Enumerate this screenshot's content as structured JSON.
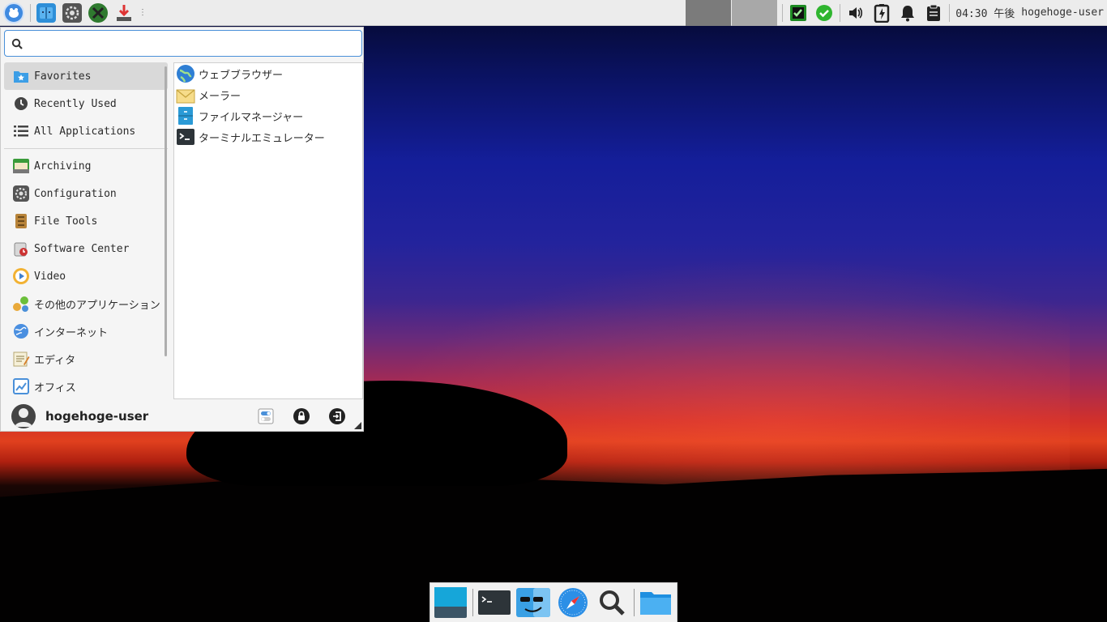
{
  "panel": {
    "clock": "04:30 午後",
    "user": "hogehoge-user",
    "handle": "⋮"
  },
  "menu": {
    "search": {
      "value": "",
      "placeholder": ""
    },
    "categories": [
      {
        "label": "Favorites",
        "icon": "folder-star-icon"
      },
      {
        "label": "Recently Used",
        "icon": "clock-icon"
      },
      {
        "label": "All Applications",
        "icon": "list-icon"
      },
      {
        "label": "Archiving",
        "icon": "archive-icon"
      },
      {
        "label": "Configuration",
        "icon": "gear-icon"
      },
      {
        "label": "File Tools",
        "icon": "file-tools-icon"
      },
      {
        "label": "Software Center",
        "icon": "software-center-icon"
      },
      {
        "label": "Video",
        "icon": "video-icon"
      },
      {
        "label": "その他のアプリケーション",
        "icon": "other-apps-icon"
      },
      {
        "label": "インターネット",
        "icon": "internet-icon"
      },
      {
        "label": "エディタ",
        "icon": "editor-icon"
      },
      {
        "label": "オフィス",
        "icon": "office-icon"
      }
    ],
    "apps": [
      {
        "label": "ウェブブラウザー",
        "icon": "globe-icon"
      },
      {
        "label": "メーラー",
        "icon": "mail-icon"
      },
      {
        "label": "ファイルマネージャー",
        "icon": "file-manager-icon"
      },
      {
        "label": "ターミナルエミュレーター",
        "icon": "terminal-icon"
      }
    ],
    "footer": {
      "username": "hogehoge-user"
    }
  },
  "colors": {
    "accent": "#4a90d9",
    "panel_bg": "#ececec",
    "menu_bg": "#f5f5f5",
    "active_category": "#d9d9d9"
  }
}
